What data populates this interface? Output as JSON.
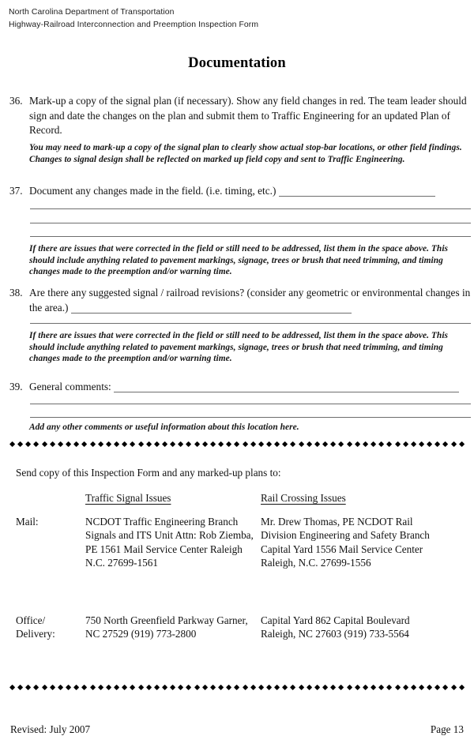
{
  "header": {
    "line1": "North Carolina Department of Transportation",
    "line2": "Highway-Railroad Interconnection and Preemption Inspection Form"
  },
  "title": "Documentation",
  "items": [
    {
      "number": "36.",
      "text": "Mark-up a copy of the signal plan (if necessary).  Show any field changes in red.  The team leader should sign and date the changes on the plan and submit them to Traffic Engineering for an updated Plan of Record.",
      "note": "You may need to mark-up a copy of the signal plan to clearly show actual stop-bar locations, or other field findings.  Changes to signal design shall be reflected on marked up field copy and sent to Traffic Engineering."
    },
    {
      "number": "37.",
      "text": "Document any changes made in the field.  (i.e. timing, etc.)",
      "note": "If there are issues that were corrected in the field or still need to be addressed, list them in the space above. This should include anything related to pavement markings, signage, trees or brush that need trimming, and timing changes made to the preemption and/or warning time."
    },
    {
      "number": "38.",
      "text": "Are there any suggested signal / railroad revisions?  (consider any geometric or environmental changes in the area.)",
      "note": "If there are issues that were corrected in the field or still need to be addressed, list them in the space above. This should include anything related to pavement markings, signage, trees or brush that need trimming, and timing changes made to the preemption and/or warning time."
    },
    {
      "number": "39.",
      "text": "General comments:",
      "note": "Add any other comments or useful information about this location here."
    }
  ],
  "send_to": {
    "intro": "Send copy of this Inspection Form and any marked-up plans to:",
    "column_headers": [
      "Traffic Signal Issues",
      "Rail Crossing Issues"
    ],
    "rows": [
      {
        "label": "Mail:",
        "traffic_signal": "NCDOT\nTraffic Engineering Branch\nSignals and ITS Unit\nAttn:  Rob Ziemba, PE\n1561 Mail Service Center\nRaleigh N.C. 27699-1561",
        "rail_crossing": "Mr. Drew Thomas, PE\nNCDOT Rail Division\nEngineering and Safety Branch\nCapital Yard\n1556 Mail Service Center\nRaleigh, N.C. 27699-1556"
      },
      {
        "label": "Office/\nDelivery:",
        "traffic_signal": "750 North Greenfield Parkway\nGarner, NC  27529\n(919) 773-2800",
        "rail_crossing": "Capital Yard\n862 Capital Boulevard\nRaleigh, NC 27603\n(919) 733-5564"
      }
    ]
  },
  "footer": {
    "revised": "Revised:  July 2007",
    "page": "Page 13"
  }
}
